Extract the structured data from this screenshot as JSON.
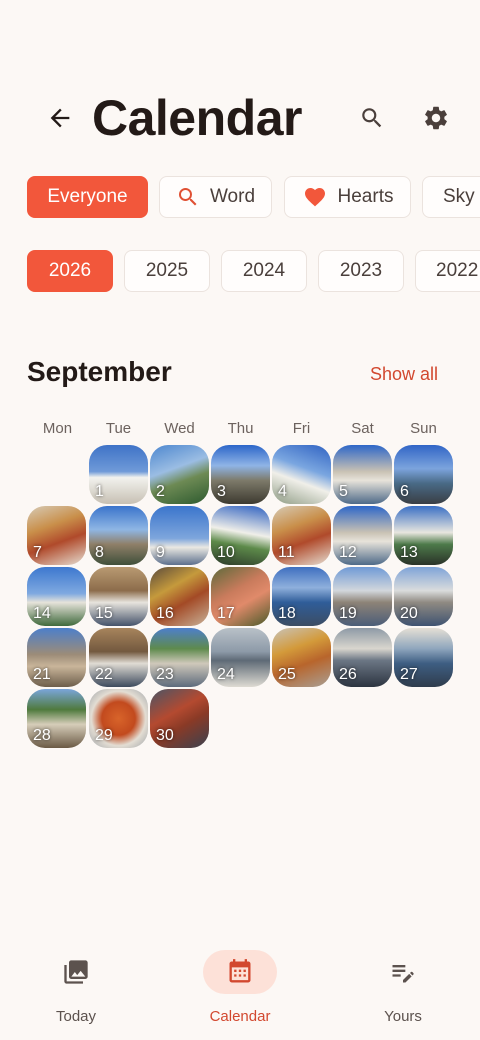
{
  "header": {
    "title": "Calendar"
  },
  "filters": [
    {
      "label": "Everyone",
      "icon": "",
      "active": true
    },
    {
      "label": "Word",
      "icon": "search-icon",
      "active": false
    },
    {
      "label": "Hearts",
      "icon": "heart-icon",
      "active": false
    },
    {
      "label": "Sky",
      "icon": "",
      "active": false
    }
  ],
  "years": [
    {
      "label": "2026",
      "active": true
    },
    {
      "label": "2025",
      "active": false
    },
    {
      "label": "2024",
      "active": false
    },
    {
      "label": "2023",
      "active": false
    },
    {
      "label": "2022",
      "active": false
    }
  ],
  "month": {
    "name": "September",
    "show_all_label": "Show all",
    "weekdays": [
      "Mon",
      "Tue",
      "Wed",
      "Thu",
      "Fri",
      "Sat",
      "Sun"
    ],
    "days": [
      "1",
      "2",
      "3",
      "4",
      "5",
      "6",
      "7",
      "8",
      "9",
      "10",
      "11",
      "12",
      "13",
      "14",
      "15",
      "16",
      "17",
      "18",
      "19",
      "20",
      "21",
      "22",
      "23",
      "24",
      "25",
      "26",
      "27",
      "28",
      "29",
      "30"
    ]
  },
  "nav": {
    "items": [
      {
        "label": "Today",
        "icon": "photo-icon",
        "active": false
      },
      {
        "label": "Calendar",
        "icon": "calendar-icon",
        "active": true
      },
      {
        "label": "Yours",
        "icon": "edit-note-icon",
        "active": false
      }
    ]
  },
  "colors": {
    "accent": "#f2573b",
    "accent_text": "#d2482f",
    "background": "#fcf8f5"
  }
}
